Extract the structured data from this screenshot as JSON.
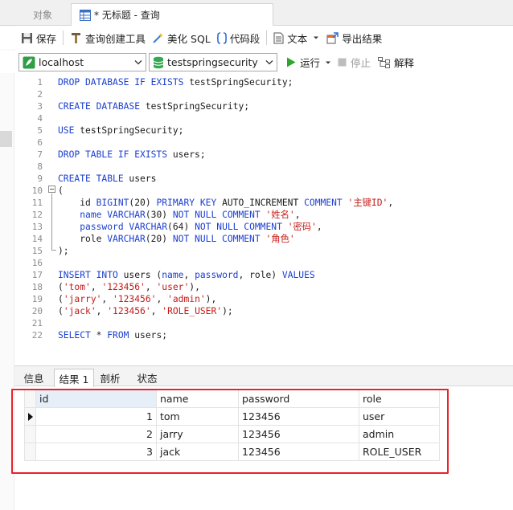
{
  "tabs": {
    "objects_label": "对象",
    "query_title": "* 无标题 - 查询"
  },
  "toolbar": {
    "save_label": "保存",
    "query_builder_label": "查询创建工具",
    "beautify_label": "美化 SQL",
    "snippet_label": "代码段",
    "text_label": "文本",
    "export_label": "导出结果"
  },
  "connection": {
    "connection_value": "localhost",
    "database_value": "testspringsecurity",
    "run_label": "运行",
    "stop_label": "停止",
    "explain_label": "解释"
  },
  "editor": {
    "lines": [
      {
        "n": "1",
        "tokens": [
          [
            "kw",
            "DROP DATABASE IF EXISTS "
          ],
          [
            "tok",
            "testSpringSecurity;"
          ]
        ]
      },
      {
        "n": "2",
        "tokens": []
      },
      {
        "n": "3",
        "tokens": [
          [
            "kw",
            "CREATE DATABASE "
          ],
          [
            "tok",
            "testSpringSecurity;"
          ]
        ]
      },
      {
        "n": "4",
        "tokens": []
      },
      {
        "n": "5",
        "tokens": [
          [
            "kw",
            "USE "
          ],
          [
            "tok",
            "testSpringSecurity;"
          ]
        ]
      },
      {
        "n": "6",
        "tokens": []
      },
      {
        "n": "7",
        "tokens": [
          [
            "kw",
            "DROP TABLE IF EXISTS "
          ],
          [
            "tok",
            "users;"
          ]
        ]
      },
      {
        "n": "8",
        "tokens": []
      },
      {
        "n": "9",
        "tokens": [
          [
            "kw",
            "CREATE TABLE "
          ],
          [
            "tok",
            "users"
          ]
        ]
      },
      {
        "n": "10",
        "tokens": [
          [
            "tok",
            "("
          ]
        ]
      },
      {
        "n": "11",
        "tokens": [
          [
            "tok",
            "    id "
          ],
          [
            "kw",
            "BIGINT"
          ],
          [
            "tok",
            "(20) "
          ],
          [
            "kw",
            "PRIMARY KEY "
          ],
          [
            "tok",
            "AUTO_INCREMENT "
          ],
          [
            "kw",
            "COMMENT "
          ],
          [
            "str",
            "'主键ID'"
          ],
          [
            "tok",
            ","
          ]
        ]
      },
      {
        "n": "12",
        "tokens": [
          [
            "tok",
            "    "
          ],
          [
            "kw",
            "name VARCHAR"
          ],
          [
            "tok",
            "(30) "
          ],
          [
            "kw",
            "NOT NULL COMMENT "
          ],
          [
            "str",
            "'姓名'"
          ],
          [
            "tok",
            ","
          ]
        ]
      },
      {
        "n": "13",
        "tokens": [
          [
            "tok",
            "    "
          ],
          [
            "kw",
            "password VARCHAR"
          ],
          [
            "tok",
            "(64) "
          ],
          [
            "kw",
            "NOT NULL COMMENT "
          ],
          [
            "str",
            "'密码'"
          ],
          [
            "tok",
            ","
          ]
        ]
      },
      {
        "n": "14",
        "tokens": [
          [
            "tok",
            "    role "
          ],
          [
            "kw",
            "VARCHAR"
          ],
          [
            "tok",
            "(20) "
          ],
          [
            "kw",
            "NOT NULL COMMENT "
          ],
          [
            "str",
            "'角色'"
          ]
        ]
      },
      {
        "n": "15",
        "tokens": [
          [
            "tok",
            ");"
          ]
        ]
      },
      {
        "n": "16",
        "tokens": []
      },
      {
        "n": "17",
        "tokens": [
          [
            "kw",
            "INSERT INTO "
          ],
          [
            "tok",
            "users ("
          ],
          [
            "kw",
            "name"
          ],
          [
            "tok",
            ", "
          ],
          [
            "kw",
            "password"
          ],
          [
            "tok",
            ", role) "
          ],
          [
            "kw",
            "VALUES"
          ]
        ]
      },
      {
        "n": "18",
        "tokens": [
          [
            "tok",
            "("
          ],
          [
            "str",
            "'tom'"
          ],
          [
            "tok",
            ", "
          ],
          [
            "str",
            "'123456'"
          ],
          [
            "tok",
            ", "
          ],
          [
            "str",
            "'user'"
          ],
          [
            "tok",
            "),"
          ]
        ]
      },
      {
        "n": "19",
        "tokens": [
          [
            "tok",
            "("
          ],
          [
            "str",
            "'jarry'"
          ],
          [
            "tok",
            ", "
          ],
          [
            "str",
            "'123456'"
          ],
          [
            "tok",
            ", "
          ],
          [
            "str",
            "'admin'"
          ],
          [
            "tok",
            "),"
          ]
        ]
      },
      {
        "n": "20",
        "tokens": [
          [
            "tok",
            "("
          ],
          [
            "str",
            "'jack'"
          ],
          [
            "tok",
            ", "
          ],
          [
            "str",
            "'123456'"
          ],
          [
            "tok",
            ", "
          ],
          [
            "str",
            "'ROLE_USER'"
          ],
          [
            "tok",
            ");"
          ]
        ]
      },
      {
        "n": "21",
        "tokens": []
      },
      {
        "n": "22",
        "tokens": [
          [
            "kw",
            "SELECT "
          ],
          [
            "tok",
            "* "
          ],
          [
            "kw",
            "FROM "
          ],
          [
            "tok",
            "users;"
          ]
        ]
      }
    ]
  },
  "result_tabs": [
    "信息",
    "结果 1",
    "剖析",
    "状态"
  ],
  "result": {
    "columns": [
      "id",
      "name",
      "password",
      "role"
    ],
    "rows": [
      [
        "1",
        "tom",
        "123456",
        "user"
      ],
      [
        "2",
        "jarry",
        "123456",
        "admin"
      ],
      [
        "3",
        "jack",
        "123456",
        "ROLE_USER"
      ]
    ]
  },
  "colors": {
    "keyword": "#1b3fd0",
    "string": "#c41a16",
    "highlight_border": "#e8232b",
    "run_green": "#2fa52f"
  }
}
